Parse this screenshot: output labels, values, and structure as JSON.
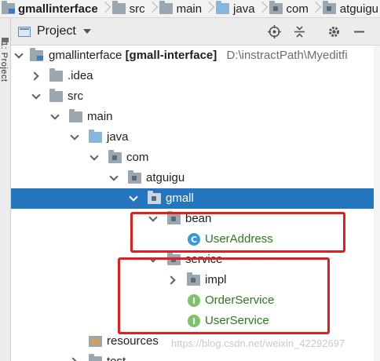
{
  "breadcrumbs": [
    {
      "label": "gmallinterface",
      "icon": "module-folder-icon"
    },
    {
      "label": "src",
      "icon": "folder-icon"
    },
    {
      "label": "main",
      "icon": "folder-icon"
    },
    {
      "label": "java",
      "icon": "source-folder-icon"
    },
    {
      "label": "com",
      "icon": "package-icon"
    },
    {
      "label": "atguigu",
      "icon": "package-icon"
    }
  ],
  "left_strip": {
    "label": "1: Project"
  },
  "panel": {
    "title": "Project",
    "tools": [
      "locate-icon",
      "collapse-all-icon",
      "gear-icon",
      "minimize-icon"
    ]
  },
  "tree": {
    "root_name": "gmallinterface",
    "root_module": "[gmall-interface]",
    "root_path": "D:\\instractPath\\Myeditfi",
    "idea": ".idea",
    "src": "src",
    "main": "main",
    "java": "java",
    "com": "com",
    "atguigu": "atguigu",
    "gmall": "gmall",
    "bean": "bean",
    "user_address": "UserAddress",
    "service": "service",
    "impl": "impl",
    "order_service": "OrderService",
    "user_service": "UserService",
    "resources": "resources",
    "next_hint": "test"
  },
  "watermark": "https://blog.csdn.net/weixin_42292697",
  "colors": {
    "selection": "#2675bf",
    "highlight_box": "#e02020",
    "class_text": "#2a7a1e"
  }
}
